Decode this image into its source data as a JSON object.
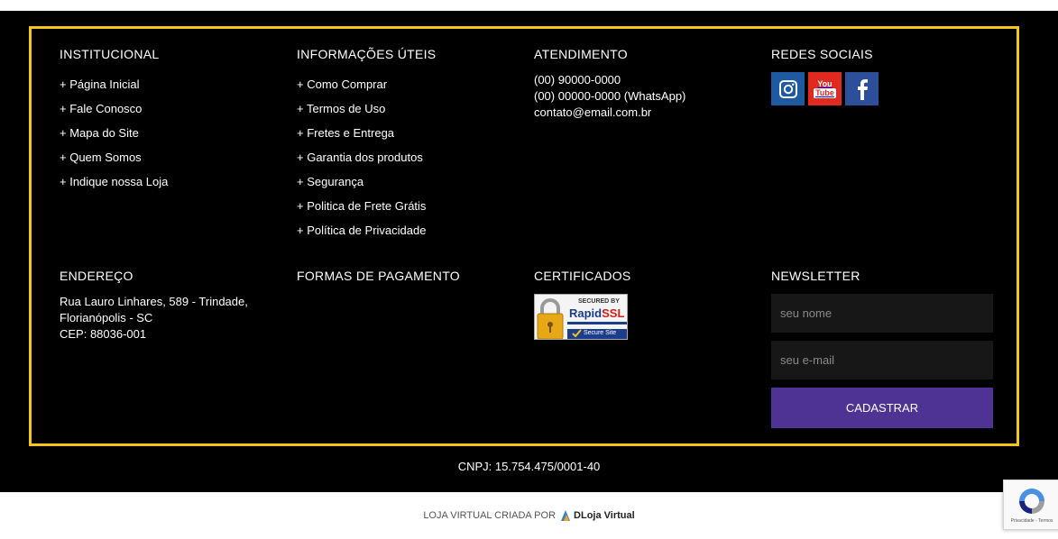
{
  "institucional": {
    "title": "INSTITUCIONAL",
    "items": [
      "+ Página Inicial",
      "+ Fale Conosco",
      "+ Mapa do Site",
      "+ Quem Somos",
      "+ Indique nossa Loja"
    ]
  },
  "informacoes": {
    "title": "INFORMAÇÕES ÚTEIS",
    "items": [
      "+ Como Comprar",
      "+ Termos de Uso",
      "+ Fretes e Entrega",
      "+ Garantia dos produtos",
      "+ Segurança",
      "+ Politica de Frete Grátis",
      "+ Política de Privacidade"
    ]
  },
  "atendimento": {
    "title": "ATENDIMENTO",
    "phone": "(00) 90000-0000",
    "whatsapp": "(00) 00000-0000 (WhatsApp)",
    "email": "contato@email.com.br"
  },
  "redes": {
    "title": "REDES SOCIAIS",
    "icons": [
      "instagram-icon",
      "youtube-icon",
      "facebook-icon"
    ],
    "youtube_top": "You",
    "youtube_bottom": "Tube"
  },
  "endereco": {
    "title": "ENDEREÇO",
    "line1": "Rua Lauro Linhares, 589 - Trindade,",
    "line2": "Florianópolis - SC",
    "line3": "CEP: 88036-001"
  },
  "pagamento": {
    "title": "FORMAS DE PAGAMENTO"
  },
  "certificados": {
    "title": "CERTIFICADOS",
    "seal_top": "SECURED BY",
    "seal_brand_a": "Rapid",
    "seal_brand_b": "SSL",
    "seal_bottom": "Secure Site"
  },
  "newsletter": {
    "title": "NEWSLETTER",
    "name_placeholder": "seu nome",
    "email_placeholder": "seu e-mail",
    "submit_label": "CADASTRAR"
  },
  "cnpj": "CNPJ: 15.754.475/0001-40",
  "credit": {
    "text": "LOJA VIRTUAL CRIADA POR",
    "brand": "DLoja Virtual"
  },
  "recaptcha": {
    "text": "Privacidade - Termos"
  },
  "colors": {
    "border": "#f5c518",
    "button": "#4f3394",
    "background": "#000000"
  }
}
